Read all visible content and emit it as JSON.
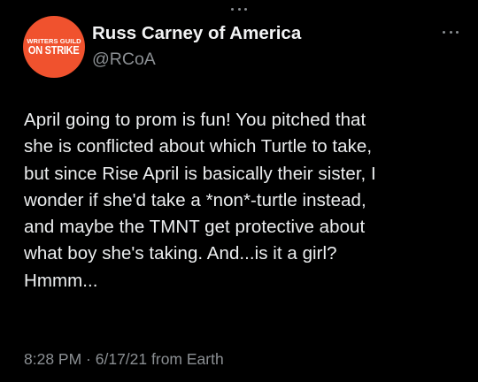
{
  "top_indicator": {
    "icon": "ellipsis-icon"
  },
  "author": {
    "avatar": {
      "line1": "WRITERS GUILD",
      "line2": "ON STRIKE",
      "color": "#f0522e"
    },
    "display_name": "Russ Carney of America",
    "handle": "@RCoA"
  },
  "more_button": {
    "icon": "more-options-icon"
  },
  "tweet": {
    "text": "April going to prom is fun! You pitched that\nshe is conflicted about which Turtle to take,\nbut since Rise April is basically their sister, I\nwonder if she'd take a *non*-turtle instead,\nand maybe the TMNT get protective about\nwhat boy she's taking. And...is it a girl?\nHmmm..."
  },
  "meta": {
    "time": "8:28 PM",
    "separator": " · ",
    "date": "6/17/21",
    "source": " from Earth"
  },
  "colors": {
    "background": "#000000",
    "text": "#eceeef",
    "secondary": "#8b8f93"
  }
}
